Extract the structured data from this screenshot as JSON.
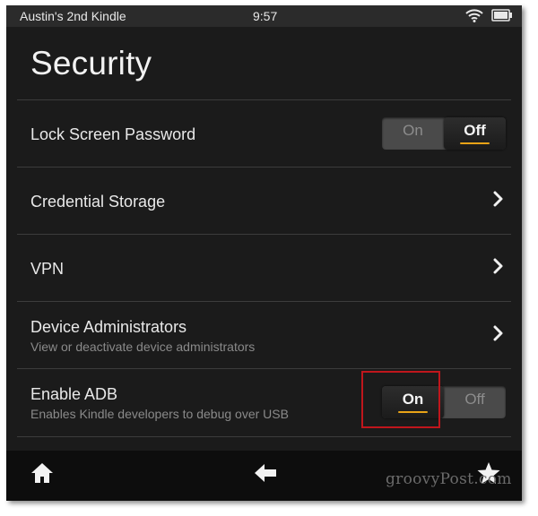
{
  "status_bar": {
    "device_name": "Austin's 2nd Kindle",
    "time": "9:57",
    "icons": [
      "wifi-icon",
      "battery-icon"
    ]
  },
  "page": {
    "title": "Security"
  },
  "settings": {
    "lock_screen": {
      "label": "Lock Screen Password",
      "toggle_on": "On",
      "toggle_off": "Off",
      "selected": "Off"
    },
    "credential_storage": {
      "label": "Credential Storage"
    },
    "vpn": {
      "label": "VPN"
    },
    "device_admins": {
      "label": "Device Administrators",
      "sub": "View or deactivate device administrators"
    },
    "enable_adb": {
      "label": "Enable ADB",
      "sub": "Enables Kindle developers to debug over USB",
      "toggle_on": "On",
      "toggle_off": "Off",
      "selected": "On"
    }
  },
  "bottom_nav": {
    "icons": [
      "home-icon",
      "back-arrow-icon",
      "favorites-star-icon"
    ]
  },
  "colors": {
    "accent": "#e8a317",
    "highlight": "#c0161c",
    "background": "#1b1b1b"
  },
  "watermark": "groovyPost.com"
}
